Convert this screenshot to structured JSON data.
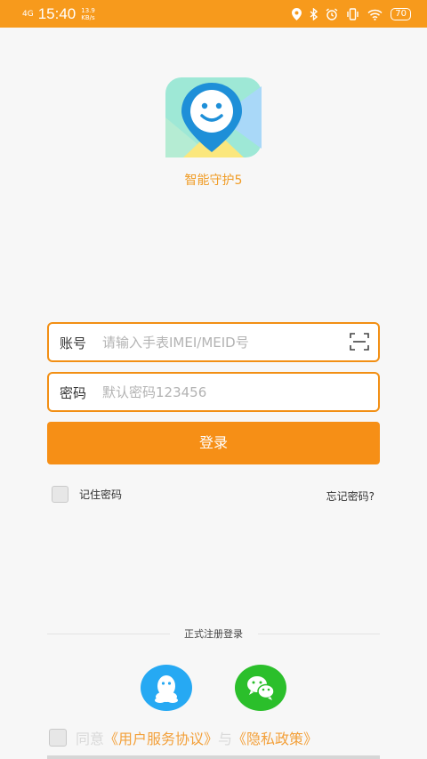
{
  "status_bar": {
    "signal": "4G",
    "time": "15:40",
    "net_speed": "13.9 KB/s",
    "battery": "70"
  },
  "app": {
    "name": "智能守护5"
  },
  "login_form": {
    "account_label": "账号",
    "account_placeholder": "请输入手表IMEI/MEID号",
    "password_label": "密码",
    "password_placeholder": "默认密码123456",
    "login_button": "登录",
    "remember_label": "记住密码",
    "forgot_label": "忘记密码?"
  },
  "register": {
    "divider_text": "正式注册登录"
  },
  "agreement": {
    "agree_text": "同意",
    "terms_link": "《用户服务协议》",
    "and_text": "与",
    "privacy_link": "《隐私政策》"
  },
  "colors": {
    "accent": "#f68f16",
    "qq": "#26a9f3",
    "wechat": "#2bbf2b"
  }
}
